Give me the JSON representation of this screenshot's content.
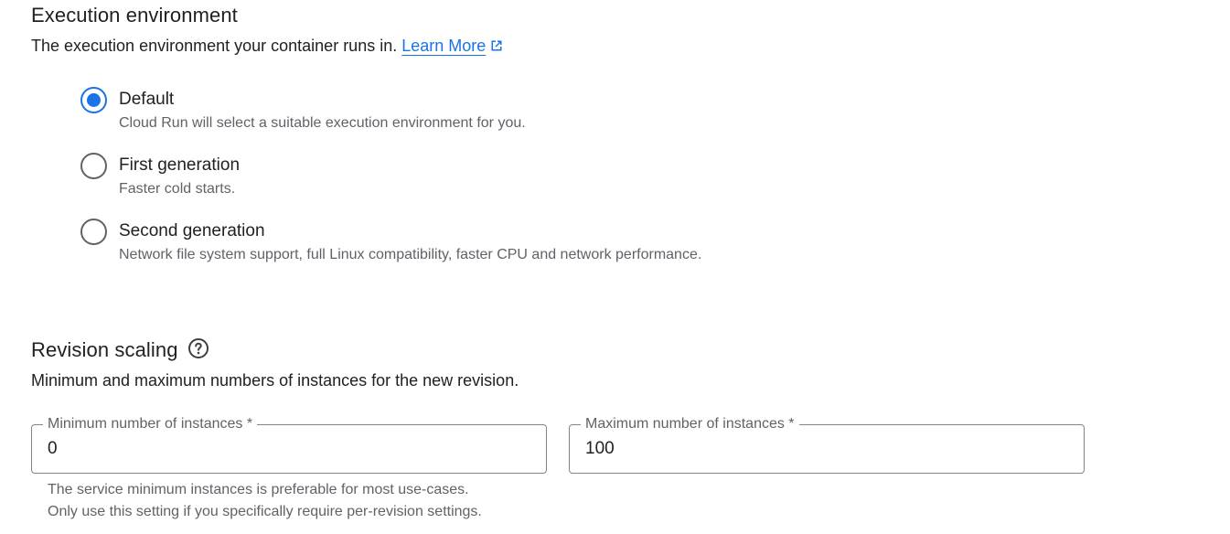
{
  "execution_env": {
    "title": "Execution environment",
    "description": "The execution environment your container runs in.",
    "learn_more": "Learn More",
    "options": [
      {
        "label": "Default",
        "desc": "Cloud Run will select a suitable execution environment for you.",
        "checked": true
      },
      {
        "label": "First generation",
        "desc": "Faster cold starts.",
        "checked": false
      },
      {
        "label": "Second generation",
        "desc": "Network file system support, full Linux compatibility, faster CPU and network performance.",
        "checked": false
      }
    ]
  },
  "revision_scaling": {
    "title": "Revision scaling",
    "help_icon": "help-circle-icon",
    "description": "Minimum and maximum numbers of instances for the new revision.",
    "min_field": {
      "label": "Minimum number of instances *",
      "value": "0"
    },
    "max_field": {
      "label": "Maximum number of instances *",
      "value": "100"
    },
    "min_hint": "The service minimum instances is preferable for most use-cases. Only use this setting if you specifically require per-revision settings."
  },
  "colors": {
    "accent": "#1a73e8",
    "text_primary": "#202124",
    "text_secondary": "#5f6368",
    "border": "#80868b"
  }
}
